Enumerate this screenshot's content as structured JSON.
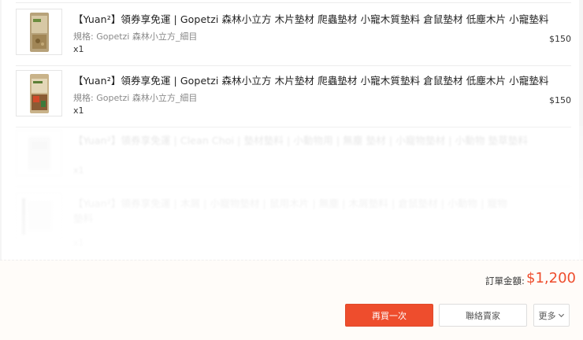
{
  "items": [
    {
      "title": "【Yuan²】領券享免運 | Gopetzi 森林小立方 木片墊材 爬蟲墊材 小寵木質墊料 倉鼠墊材 低塵木片 小寵墊料",
      "variant": "規格: Gopetzi 森林小立方_細目",
      "qty": "x1",
      "price": "$150",
      "thumb_icon": "product-bag-icon"
    },
    {
      "title": "【Yuan²】領券享免運 | Gopetzi 森林小立方 木片墊材 爬蟲墊材 小寵木質墊料 倉鼠墊材 低塵木片 小寵墊料",
      "variant": "規格: Gopetzi 森林小立方_細目",
      "qty": "x1",
      "price": "$150",
      "thumb_icon": "product-bag-icon"
    },
    {
      "title": "【Yuan²】領券享免運 | Clean Choi | 墊材墊料 | 小動物用 | 無塵 墊材 | 小寵物墊材 | 小動物 墊草墊料",
      "variant": "",
      "qty": "x1",
      "price": "",
      "thumb_icon": "product-bag-icon"
    },
    {
      "title": "【Yuan²】領券享免運 | 木屑 | 小寵物墊材 | 鼠用木片 | 無塵 | 木屑墊料 | 倉鼠墊材 | 小動物 | 寵物 墊料",
      "variant": "",
      "qty": "x1",
      "price": "",
      "thumb_icon": "product-bag-icon"
    }
  ],
  "footer": {
    "total_label": "訂單金額:",
    "total_value": "$1,200",
    "buy_again_label": "再買一次",
    "contact_seller_label": "聯絡賣家",
    "more_label": "更多"
  },
  "colors": {
    "accent": "#ee4d2d",
    "footer_bg": "#fffcf9"
  }
}
